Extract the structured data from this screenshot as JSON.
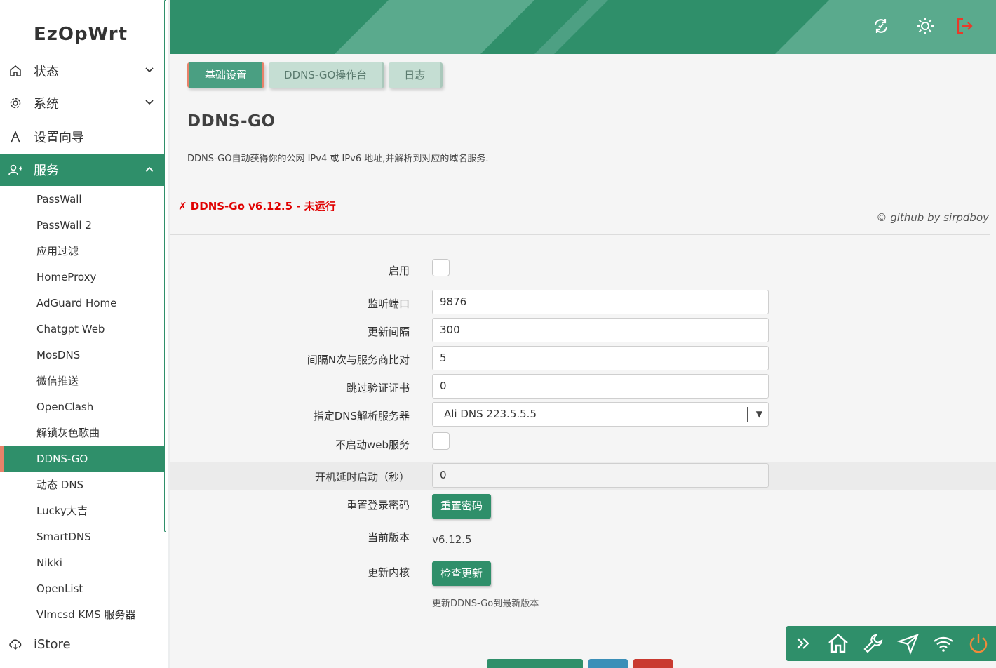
{
  "brand": "EzOpWrt",
  "menu": {
    "status": "状态",
    "system": "系统",
    "wizard": "设置向导",
    "services": "服务",
    "istore": "iStore"
  },
  "services_items": [
    "PassWall",
    "PassWall 2",
    "应用过滤",
    "HomeProxy",
    "AdGuard Home",
    "Chatgpt Web",
    "MosDNS",
    "微信推送",
    "OpenClash",
    "解锁灰色歌曲",
    "DDNS-GO",
    "动态 DNS",
    "Lucky大吉",
    "SmartDNS",
    "Nikki",
    "OpenList",
    "Vlmcsd KMS 服务器"
  ],
  "active_service": "DDNS-GO",
  "tabs": [
    "基础设置",
    "DDNS-GO操作台",
    "日志"
  ],
  "page": {
    "title": "DDNS-GO",
    "description": "DDNS-GO自动获得你的公网 IPv4 或 IPv6 地址,并解析到对应的域名服务.",
    "status": "✗ DDNS-Go v6.12.5 - 未运行",
    "credit": "© github by sirpdboy"
  },
  "form": {
    "enable_label": "启用",
    "port_label": "监听端口",
    "port_value": "9876",
    "interval_label": "更新间隔",
    "interval_value": "300",
    "compare_label": "间隔N次与服务商比对",
    "compare_value": "5",
    "skip_cert_label": "跳过验证证书",
    "skip_cert_value": "0",
    "dns_label": "指定DNS解析服务器",
    "dns_value": "Ali DNS 223.5.5.5",
    "no_web_label": "不启动web服务",
    "delay_label": "开机延时启动（秒）",
    "delay_value": "0",
    "reset_pw_label": "重置登录密码",
    "reset_pw_button": "重置密码",
    "version_label": "当前版本",
    "version_value": "v6.12.5",
    "update_label": "更新内核",
    "update_button": "检查更新",
    "update_hint": "更新DDNS-Go到最新版本"
  },
  "colors": {
    "primary": "#2f8f6a",
    "accent": "#e8826a",
    "error": "#e00000"
  }
}
